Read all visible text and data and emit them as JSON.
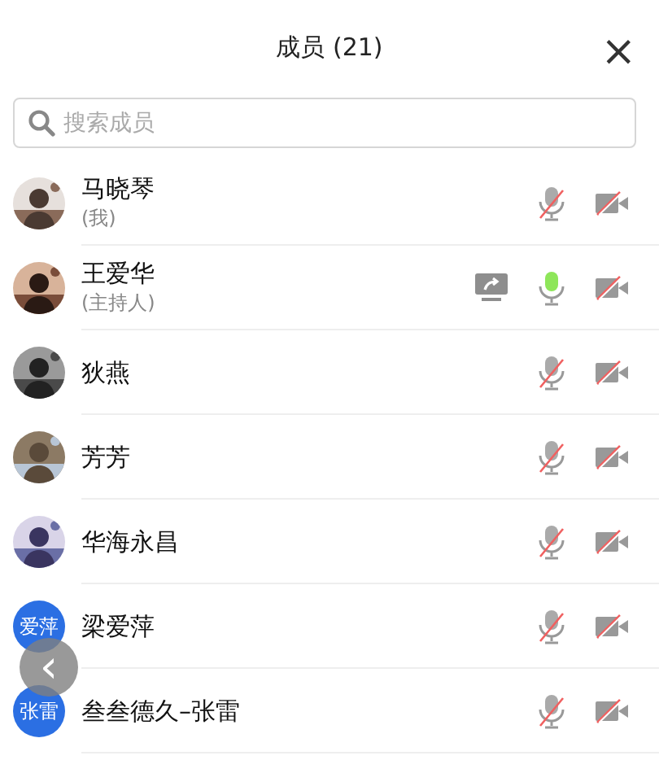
{
  "header": {
    "title": "成员 (21)",
    "close": "×"
  },
  "search": {
    "placeholder": "搜索成员"
  },
  "members": [
    {
      "name": "马晓琴",
      "role": "(我)",
      "sharing": false,
      "mic_on": false,
      "video_on": false
    },
    {
      "name": "王爱华",
      "role": "(主持人)",
      "sharing": true,
      "mic_on": true,
      "video_on": false
    },
    {
      "name": "狄燕",
      "sharing": false,
      "mic_on": false,
      "video_on": false
    },
    {
      "name": "芳芳",
      "sharing": false,
      "mic_on": false,
      "video_on": false
    },
    {
      "name": "华海永昌",
      "sharing": false,
      "mic_on": false,
      "video_on": false
    },
    {
      "name": "梁爱萍",
      "avatar": {
        "kind": "initials",
        "text": "爱萍"
      },
      "sharing": false,
      "mic_on": false,
      "video_on": false
    },
    {
      "name": "叁叁德久–张雷",
      "avatar": {
        "kind": "initials",
        "text": "张雷"
      },
      "sharing": false,
      "mic_on": false,
      "video_on": false
    }
  ],
  "back_button": {
    "label": "‹"
  }
}
